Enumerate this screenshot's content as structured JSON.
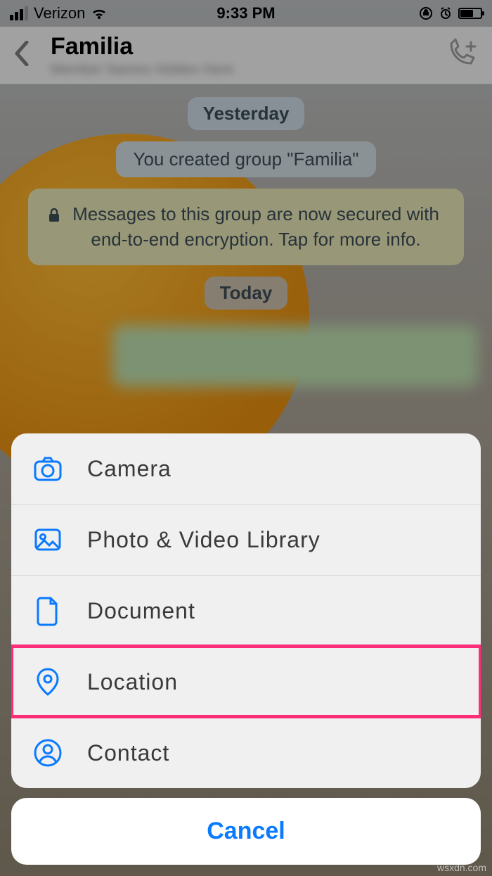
{
  "status": {
    "carrier": "Verizon",
    "time": "9:33 PM"
  },
  "header": {
    "title": "Familia"
  },
  "chat": {
    "dayLabel1": "Yesterday",
    "systemMsg": "You created group \"Familia\"",
    "encryptionMsg": "Messages to this group are now secured with end-to-end encryption. Tap for more info.",
    "dayLabel2": "Today"
  },
  "sheet": {
    "items": [
      {
        "label": "Camera"
      },
      {
        "label": "Photo & Video Library"
      },
      {
        "label": "Document"
      },
      {
        "label": "Location"
      },
      {
        "label": "Contact"
      }
    ],
    "cancel": "Cancel"
  },
  "watermark": "wsxdn.com"
}
